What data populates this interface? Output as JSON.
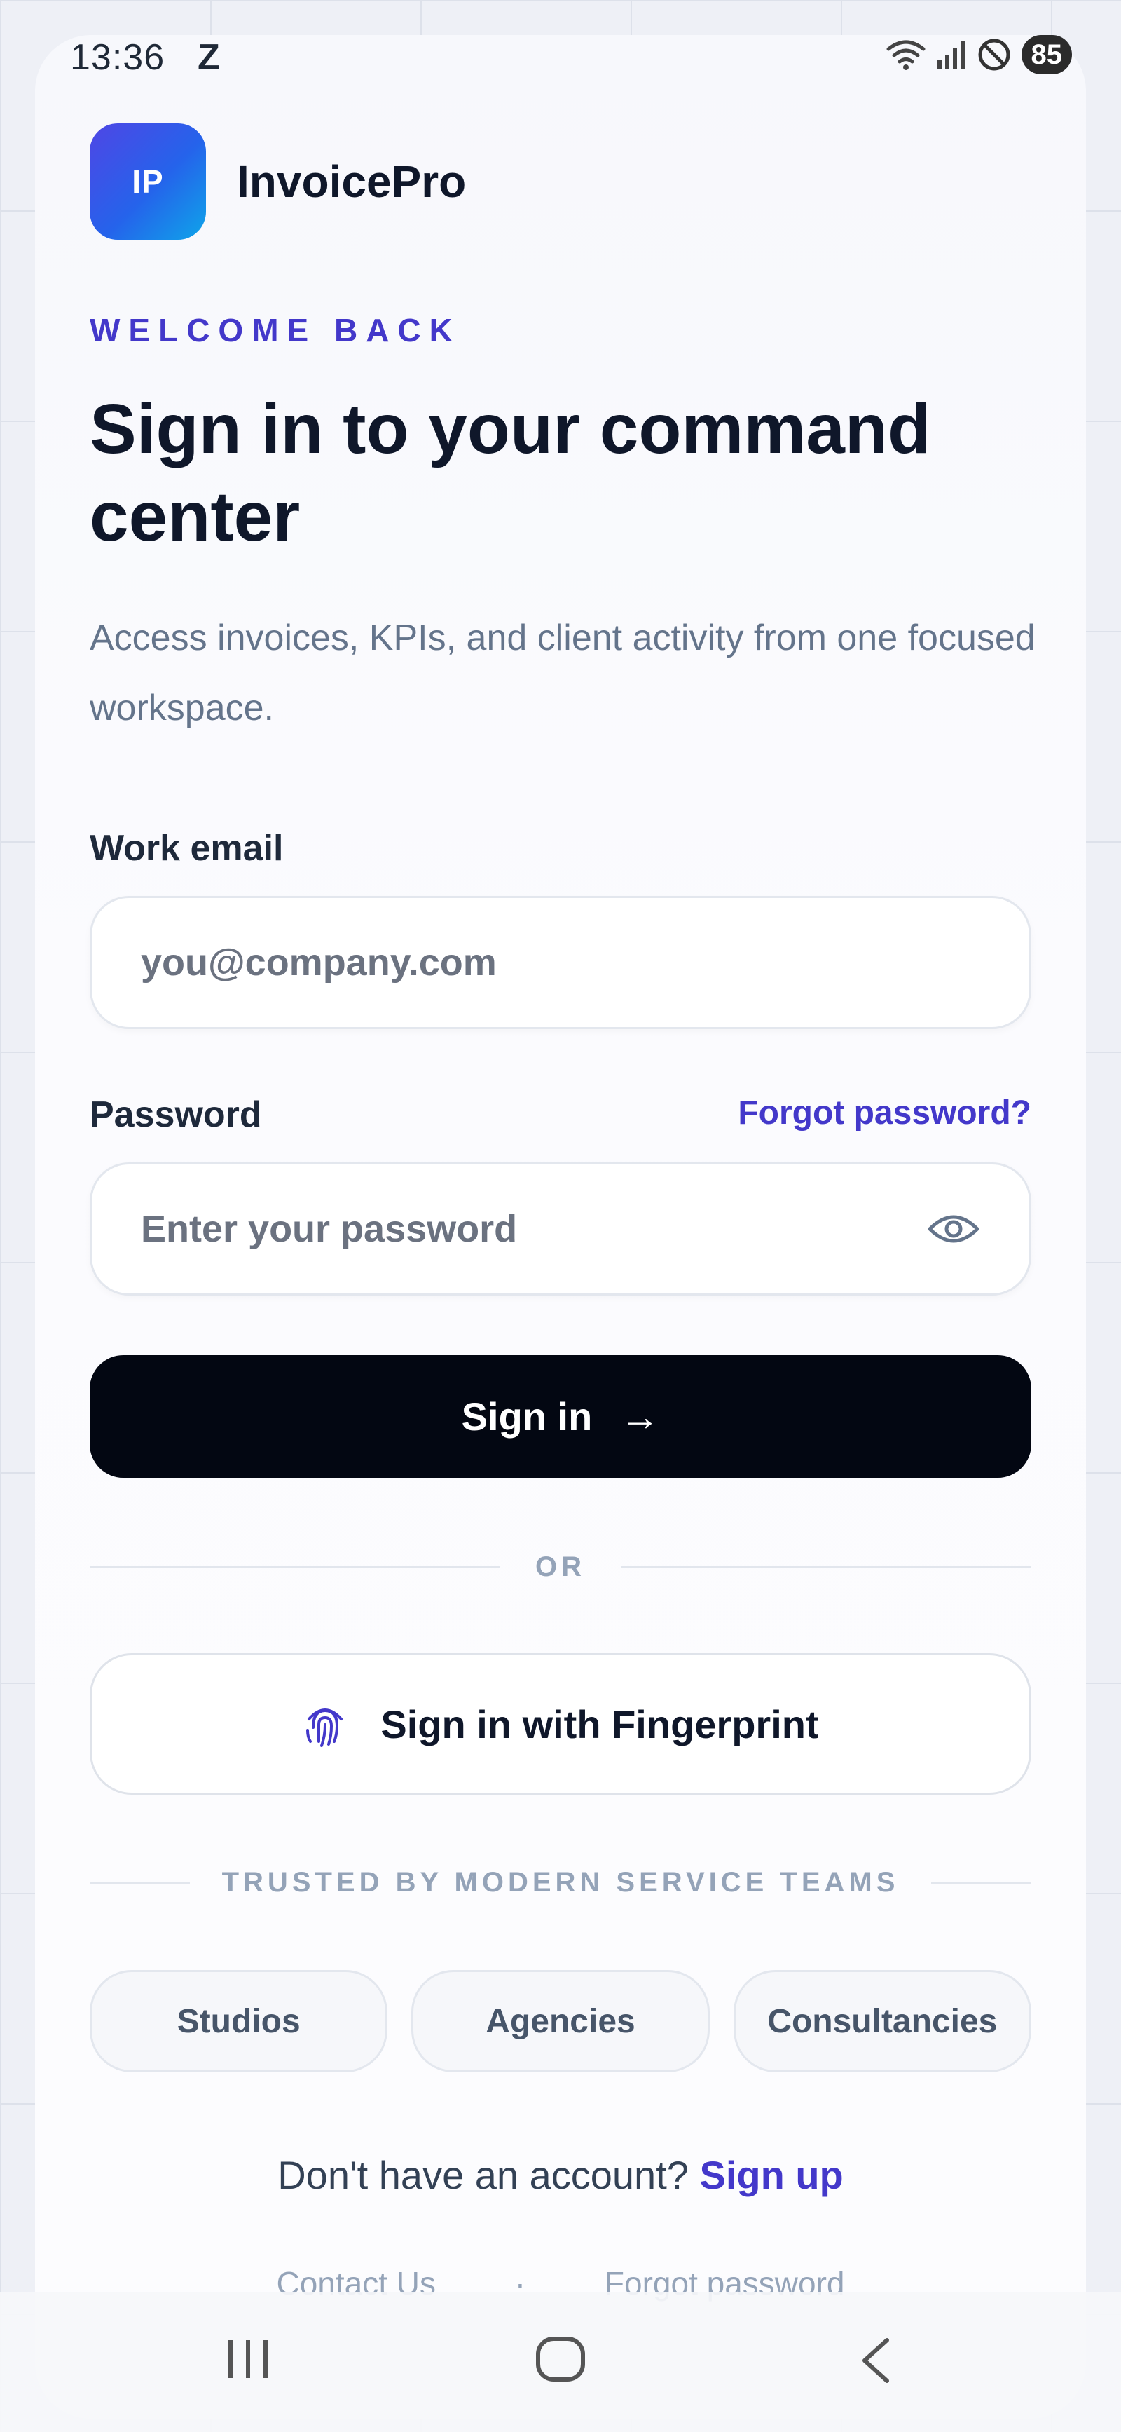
{
  "status_bar": {
    "time": "13:36",
    "indicator": "Z",
    "battery": "85",
    "icons": [
      "wifi-icon",
      "signal-icon",
      "do-not-disturb-icon"
    ]
  },
  "brand": {
    "logo_text": "IP",
    "name": "InvoicePro"
  },
  "hero": {
    "eyebrow": "WELCOME BACK",
    "title": "Sign in to your command center",
    "subtitle": "Access invoices, KPIs, and client activity from one focused workspace."
  },
  "form": {
    "email_label": "Work email",
    "email_placeholder": "you@company.com",
    "email_value": "",
    "password_label": "Password",
    "forgot_label": "Forgot password?",
    "password_placeholder": "Enter your password",
    "password_value": "",
    "sign_in_label": "Sign in",
    "sign_in_arrow": "→"
  },
  "divider_text": "OR",
  "fingerprint_label": "Sign in with Fingerprint",
  "trusted": {
    "heading": "TRUSTED BY MODERN SERVICE TEAMS",
    "chips": [
      "Studios",
      "Agencies",
      "Consultancies"
    ]
  },
  "signup": {
    "prompt": "Don't have an account?",
    "link": "Sign up"
  },
  "footer": {
    "contact": "Contact Us",
    "separator": "·",
    "forgot": "Forgot password"
  },
  "colors": {
    "accent": "#4338ca",
    "primary_button": "#030712",
    "logo_gradient_start": "#4f46e5",
    "logo_gradient_end": "#0ea5e9"
  }
}
